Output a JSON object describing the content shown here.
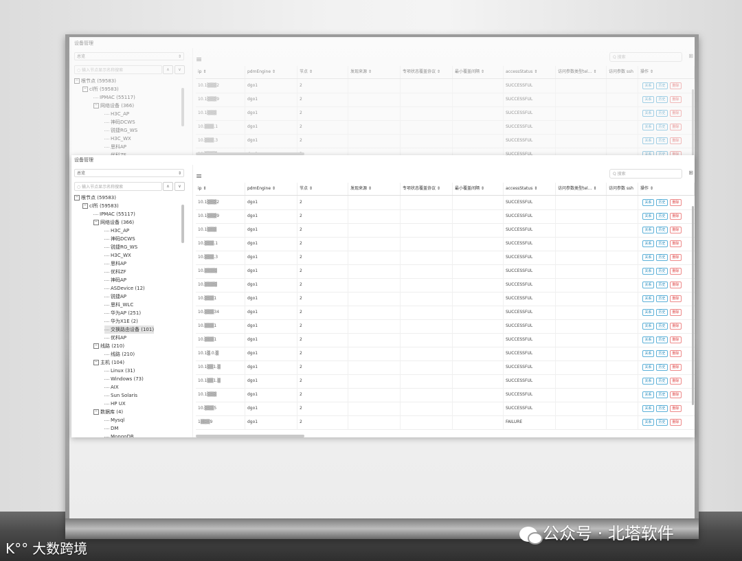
{
  "app": {
    "breadcrumb": "设备管理"
  },
  "left_panel": {
    "select_value": "总览",
    "select_caret": "⇕",
    "search_placeholder": "输入节点显示名称搜索",
    "up_label": "∧",
    "down_label": "∨",
    "tree": [
      {
        "label": "根节点 (59583)",
        "level": 0,
        "toggle": "−"
      },
      {
        "label": "cl所 (59583)",
        "level": 1,
        "toggle": "−"
      },
      {
        "label": "IPMAC (55117)",
        "level": 2,
        "toggle": ""
      },
      {
        "label": "网络设备 (366)",
        "level": 2,
        "toggle": "−"
      },
      {
        "label": "H3C_AP",
        "level": 3,
        "toggle": ""
      },
      {
        "label": "神码DCWS",
        "level": 3,
        "toggle": ""
      },
      {
        "label": "锐捷RG_WS",
        "level": 3,
        "toggle": ""
      },
      {
        "label": "H3C_WX",
        "level": 3,
        "toggle": ""
      },
      {
        "label": "思科AP",
        "level": 3,
        "toggle": ""
      },
      {
        "label": "优科ZF",
        "level": 3,
        "toggle": ""
      },
      {
        "label": "神码AP",
        "level": 3,
        "toggle": ""
      },
      {
        "label": "ASDevice (12)",
        "level": 3,
        "toggle": ""
      },
      {
        "label": "锐捷AP",
        "level": 3,
        "toggle": ""
      },
      {
        "label": "思科_WLC",
        "level": 3,
        "toggle": ""
      },
      {
        "label": "华为AP (251)",
        "level": 3,
        "toggle": ""
      },
      {
        "label": "华为X1E (2)",
        "level": 3,
        "toggle": ""
      },
      {
        "label": "交换路由设备 (101)",
        "level": 3,
        "toggle": "",
        "selected": true
      },
      {
        "label": "优科AP",
        "level": 3,
        "toggle": ""
      },
      {
        "label": "线路 (210)",
        "level": 2,
        "toggle": "−"
      },
      {
        "label": "线路 (210)",
        "level": 3,
        "toggle": ""
      },
      {
        "label": "主机 (104)",
        "level": 2,
        "toggle": "−"
      },
      {
        "label": "Linux (31)",
        "level": 3,
        "toggle": ""
      },
      {
        "label": "Windows (73)",
        "level": 3,
        "toggle": ""
      },
      {
        "label": "AIX",
        "level": 3,
        "toggle": ""
      },
      {
        "label": "Sun Solaris",
        "level": 3,
        "toggle": ""
      },
      {
        "label": "HP UX",
        "level": 3,
        "toggle": ""
      },
      {
        "label": "数据库 (4)",
        "level": 2,
        "toggle": "−"
      },
      {
        "label": "Mysql",
        "level": 3,
        "toggle": ""
      },
      {
        "label": "DM",
        "level": 3,
        "toggle": ""
      },
      {
        "label": "MongoDB",
        "level": 3,
        "toggle": ""
      }
    ]
  },
  "table": {
    "menu_icon": "≡",
    "search_placeholder": "Q 搜索",
    "grid_icon": "⊞",
    "columns": [
      "ip ⇕",
      "pdmEngine ⇕",
      "节点 ⇕",
      "发现来源 ⇕",
      "专项状态覆盖协议 ⇕",
      "最小覆盖间隔 ⇕",
      "accessStatus ⇕",
      "访问参数类型tel... ⇕",
      "访问参数 ssh",
      "操作 ⇕"
    ],
    "rows": [
      {
        "ip": "10.1▒▒▒2",
        "engine": "dgo1",
        "node": "2",
        "status": "SUCCESSFUL"
      },
      {
        "ip": "10.1▒▒▒9",
        "engine": "dgo1",
        "node": "2",
        "status": "SUCCESSFUL"
      },
      {
        "ip": "10.1▒▒▒",
        "engine": "dgo1",
        "node": "2",
        "status": "SUCCESSFUL"
      },
      {
        "ip": "10.▒▒▒.1",
        "engine": "dgo1",
        "node": "2",
        "status": "SUCCESSFUL"
      },
      {
        "ip": "10.▒▒▒.3",
        "engine": "dgo1",
        "node": "2",
        "status": "SUCCESSFUL"
      },
      {
        "ip": "10.▒▒▒▒",
        "engine": "dgo1",
        "node": "2",
        "status": "SUCCESSFUL"
      },
      {
        "ip": "10.▒▒▒▒",
        "engine": "dgo1",
        "node": "2",
        "status": "SUCCESSFUL"
      },
      {
        "ip": "10.▒▒▒1",
        "engine": "dgo1",
        "node": "2",
        "status": "SUCCESSFUL"
      },
      {
        "ip": "10.▒▒▒34",
        "engine": "dgo1",
        "node": "2",
        "status": "SUCCESSFUL"
      },
      {
        "ip": "10.▒▒▒1",
        "engine": "dgo1",
        "node": "2",
        "status": "SUCCESSFUL"
      },
      {
        "ip": "10.▒▒▒1",
        "engine": "dgo1",
        "node": "2",
        "status": "SUCCESSFUL"
      },
      {
        "ip": "10.1▒.0.▒",
        "engine": "dgo1",
        "node": "2",
        "status": "SUCCESSFUL"
      },
      {
        "ip": "10.1▒▒1.▒",
        "engine": "dgo1",
        "node": "2",
        "status": "SUCCESSFUL"
      },
      {
        "ip": "10.1▒▒1.▒",
        "engine": "dgo1",
        "node": "2",
        "status": "SUCCESSFUL"
      },
      {
        "ip": "10.1▒▒▒",
        "engine": "dgo1",
        "node": "2",
        "status": "SUCCESSFUL"
      },
      {
        "ip": "10.▒▒▒5",
        "engine": "dgo1",
        "node": "2",
        "status": "SUCCESSFUL"
      },
      {
        "ip": "1▒▒▒9",
        "engine": "dgo1",
        "node": "2",
        "status": "FAILURE"
      }
    ],
    "btn_detail": "关系",
    "btn_history": "历史",
    "btn_delete": "删除"
  },
  "watermarks": {
    "left": "大数跨境",
    "left_logo": "K°°",
    "right": "公众号 · 北塔软件"
  }
}
